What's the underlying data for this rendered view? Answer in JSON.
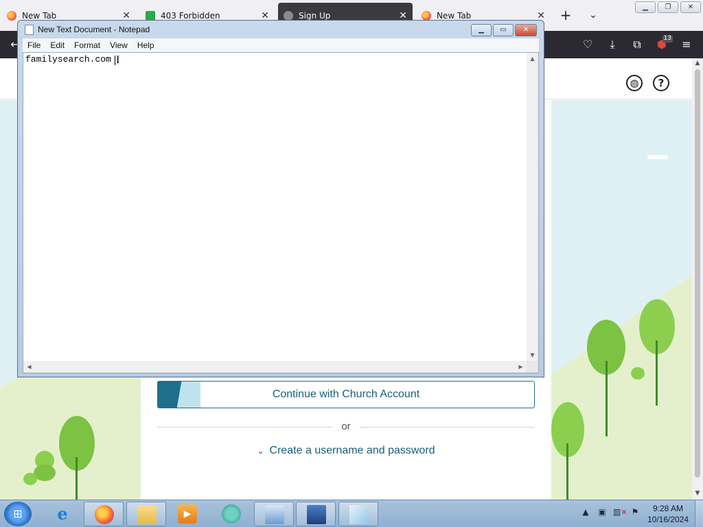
{
  "browser": {
    "tabs": [
      {
        "label": "New Tab",
        "icon": "firefox-icon",
        "active": false
      },
      {
        "label": "403 Forbidden",
        "icon": "page-icon",
        "active": false
      },
      {
        "label": "Sign Up",
        "icon": "gear-icon",
        "active": true
      },
      {
        "label": "New Tab",
        "icon": "firefox-icon",
        "active": false
      }
    ],
    "new_tab_glyph": "+",
    "tab_list_glyph": "⌄",
    "extension_badge": "13"
  },
  "site": {
    "church_button_label": "Continue with Church Account",
    "or_text": "or",
    "create_link_label": "Create a username and password",
    "accent_color": "#1a5e7a"
  },
  "notepad": {
    "title": "New Text Document - Notepad",
    "menus": [
      "File",
      "Edit",
      "Format",
      "View",
      "Help"
    ],
    "text": "familysearch.com"
  },
  "taskbar": {
    "apps": [
      {
        "name": "internet-explorer-icon",
        "open": false
      },
      {
        "name": "firefox-icon",
        "open": true
      },
      {
        "name": "folder-icon",
        "open": true
      },
      {
        "name": "media-player-icon",
        "open": false
      },
      {
        "name": "player-icon",
        "open": false
      },
      {
        "name": "control-panel-icon",
        "open": true
      },
      {
        "name": "network-icon",
        "open": true
      },
      {
        "name": "notepad-icon",
        "open": true
      }
    ],
    "clock_time": "9:28 AM",
    "clock_date": "10/16/2024"
  }
}
